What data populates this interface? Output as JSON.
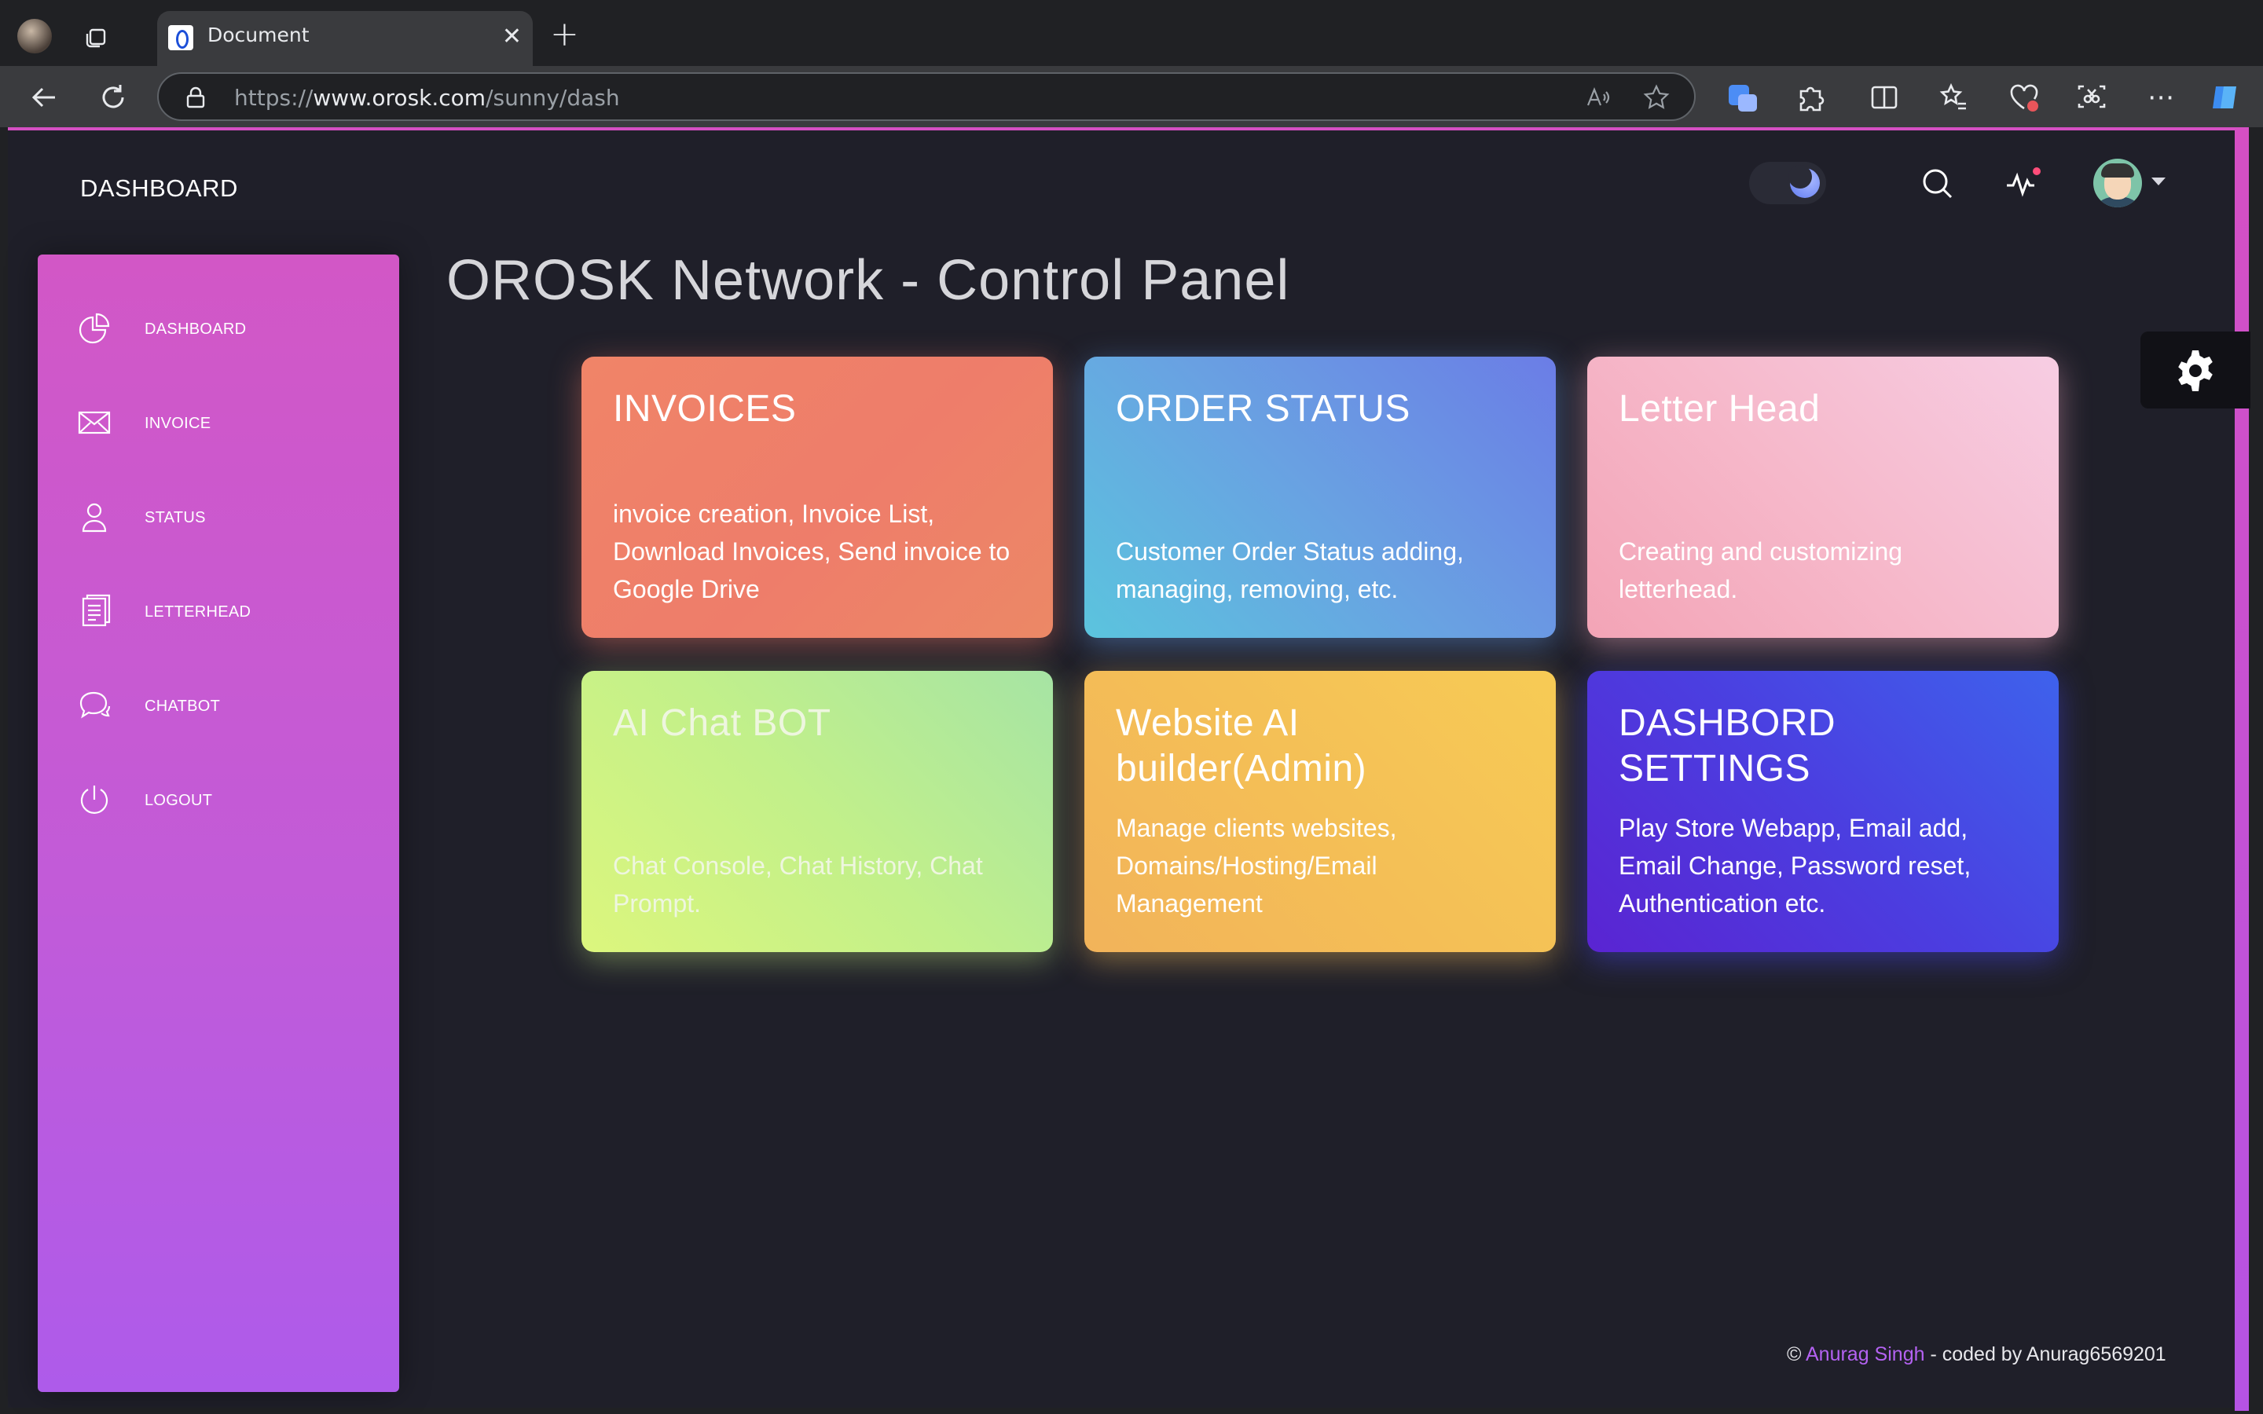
{
  "browser": {
    "tab_title": "Document",
    "new_tab_symbol": "+",
    "close_symbol": "✕",
    "url_prefix": "https://",
    "url_host": "www.orosk.com",
    "url_path": "/sunny/dash"
  },
  "header": {
    "brand": "DASHBOARD",
    "theme_toggle": "dark",
    "notification_dot_color": "#ff4d7a"
  },
  "sidebar": {
    "items": [
      {
        "label": "DASHBOARD",
        "icon": "pie-chart-icon"
      },
      {
        "label": "INVOICE",
        "icon": "mail-icon"
      },
      {
        "label": "STATUS",
        "icon": "user-icon"
      },
      {
        "label": "LETTERHEAD",
        "icon": "document-icon"
      },
      {
        "label": "CHATBOT",
        "icon": "chat-icon"
      },
      {
        "label": "LOGOUT",
        "icon": "power-icon"
      }
    ]
  },
  "main": {
    "title": "OROSK Network - Control Panel",
    "cards": [
      {
        "title": "INVOICES",
        "desc": "invoice creation, Invoice List, Download Invoices, Send invoice to Google Drive"
      },
      {
        "title": "ORDER STATUS",
        "desc": "Customer Order Status adding, managing, removing, etc."
      },
      {
        "title": "Letter Head",
        "desc": "Creating and customizing letterhead."
      },
      {
        "title": "AI Chat BOT",
        "desc": "Chat Console, Chat History, Chat Prompt."
      },
      {
        "title": "Website AI builder(Admin)",
        "desc": "Manage clients websites, Domains/Hosting/Email Management"
      },
      {
        "title": "DASHBORD SETTINGS",
        "desc": "Play Store Webapp, Email add, Email Change, Password reset, Authentication etc."
      }
    ]
  },
  "footer": {
    "copyright": "©",
    "author_link": "Anurag Singh",
    "suffix": "- coded by Anurag6569201"
  },
  "colors": {
    "accent": "#d54fc3",
    "sidebar_top": "#d257c6",
    "sidebar_bottom": "#ae5bea",
    "background": "#1f1f29",
    "footer_link": "#b462f2"
  }
}
